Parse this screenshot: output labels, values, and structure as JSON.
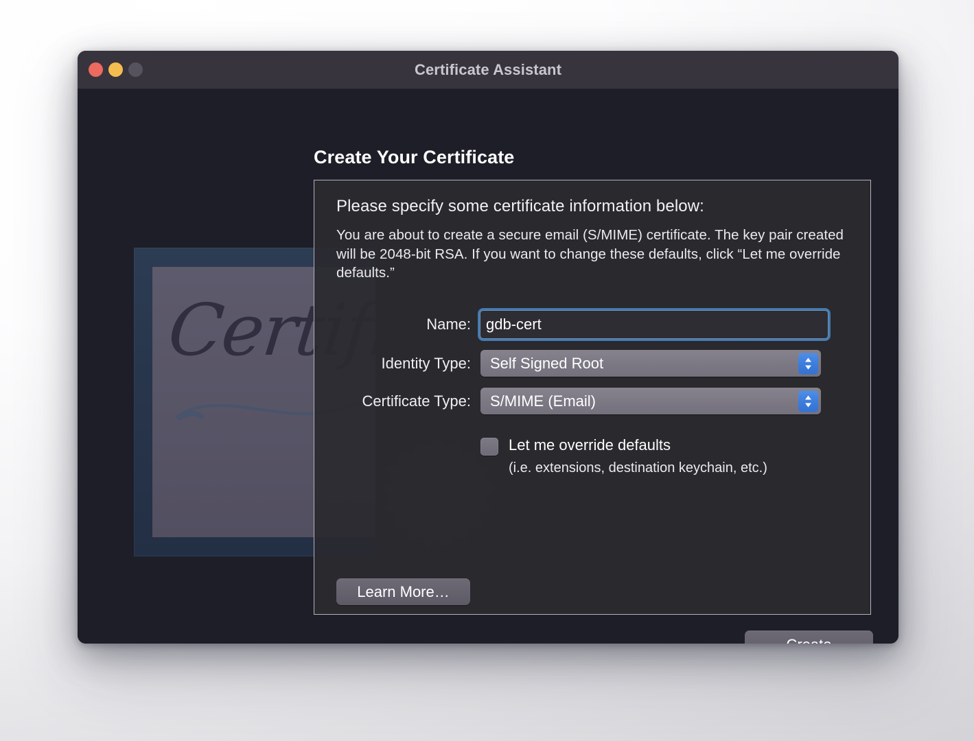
{
  "window": {
    "title": "Certificate Assistant",
    "traffic_lights": [
      {
        "name": "close",
        "color": "#ec6a5e"
      },
      {
        "name": "minimize",
        "color": "#f5bd4f"
      },
      {
        "name": "zoom",
        "color": "#56535e"
      }
    ]
  },
  "page": {
    "title": "Create Your Certificate"
  },
  "panel": {
    "heading": "Please specify some certificate information below:",
    "description": "You are about to create a secure email (S/MIME) certificate. The key pair created will be 2048-bit RSA. If you want to change these defaults, click “Let me override defaults.”"
  },
  "form": {
    "name": {
      "label": "Name:",
      "value": "gdb-cert",
      "placeholder": ""
    },
    "identity_type": {
      "label": "Identity Type:",
      "value": "Self Signed Root"
    },
    "certificate_type": {
      "label": "Certificate Type:",
      "value": "S/MIME (Email)"
    },
    "override": {
      "label": "Let me override defaults",
      "sublabel": "(i.e. extensions, destination keychain, etc.)",
      "checked": false
    }
  },
  "buttons": {
    "learn_more": "Learn More…",
    "create": "Create"
  },
  "artwork": {
    "script_text": "Certificate",
    "frame_color": "#2a3a4e",
    "paper_color": "#5a5668",
    "ink_color": "#2e2b3d"
  },
  "colors": {
    "titlebar": "#37343e",
    "window_body": "#1e1e28",
    "panel_fill": "#2a2a2f",
    "panel_border": "#b4b2bb",
    "accent_blue": "#3d7ddc",
    "focus_ring": "#4a87c7",
    "text_primary": "#ffffff",
    "title_text": "#c9c6d0"
  }
}
